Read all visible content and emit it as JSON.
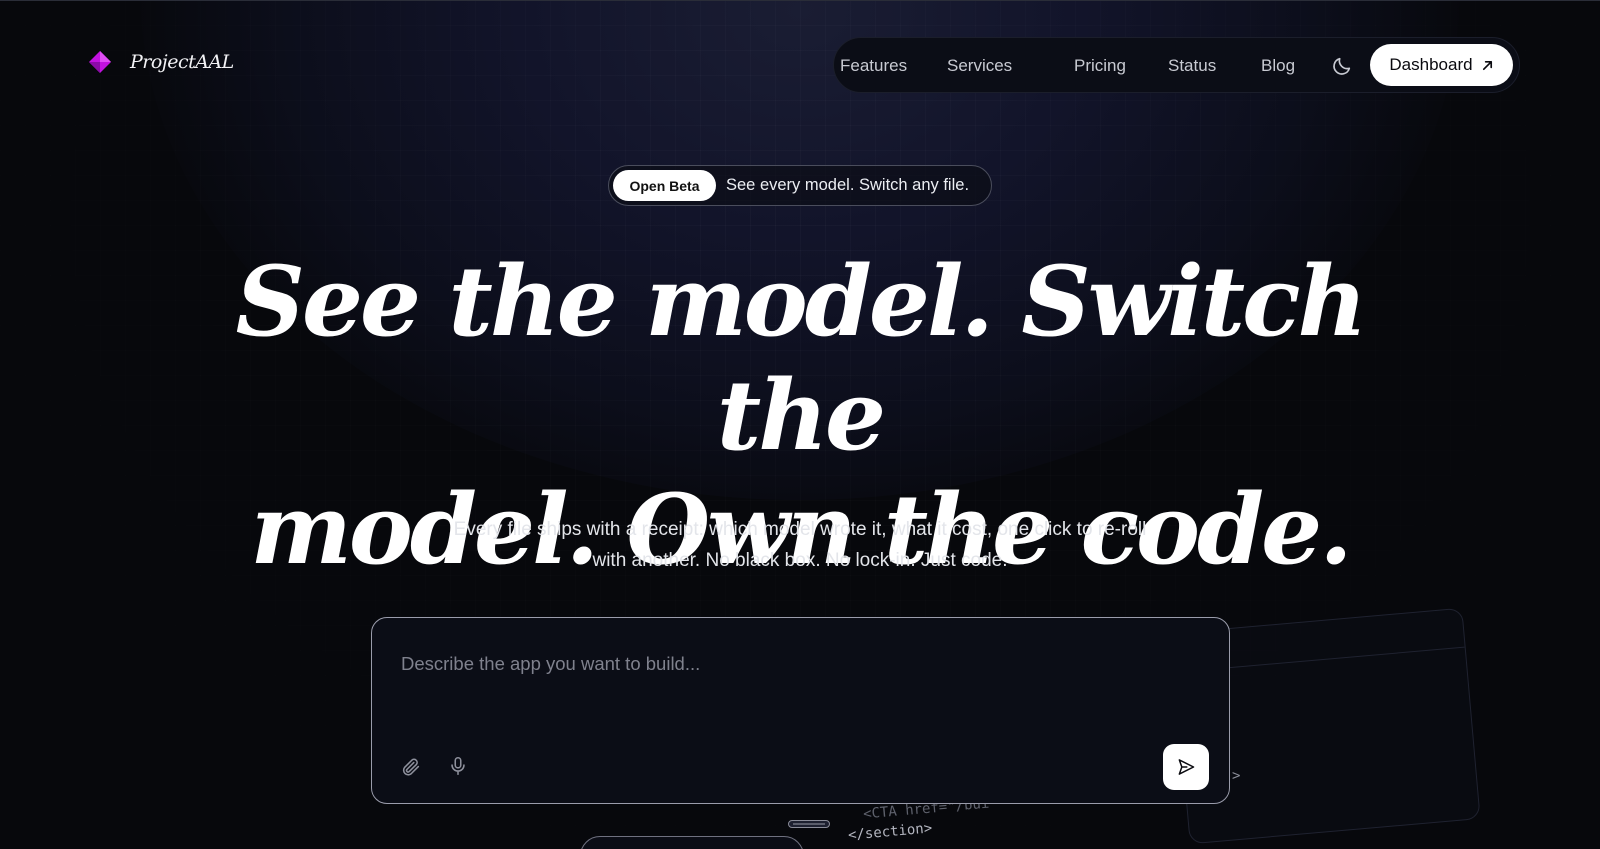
{
  "brand": {
    "name": "ProjectAAL",
    "accent": "#c212e0"
  },
  "nav": {
    "links": [
      "Features",
      "Services",
      "Pricing",
      "Status",
      "Blog"
    ],
    "theme_toggle_icon": "moon-icon",
    "dashboard_label": "Dashboard",
    "dashboard_icon": "arrow-up-right-icon"
  },
  "badge": {
    "label": "Open Beta",
    "text": "See every model. Switch any file."
  },
  "hero": {
    "line1": "See the model. Switch the",
    "line2": "model. Own the code."
  },
  "subtitle": {
    "line1": "Every file ships with a receipt: which model wrote it, what it cost, one click to re-roll",
    "line2": "with another. No black box. No lock-in. Just code."
  },
  "prompt": {
    "placeholder": "Describe the app you want to build...",
    "value": "",
    "attach_icon": "paperclip-icon",
    "mic_icon": "microphone-icon",
    "send_icon": "send-icon"
  },
  "decor": {
    "code_line1": "<CTA href=\"/bui",
    "code_line2": "</section>",
    "code_fragment": ">"
  }
}
